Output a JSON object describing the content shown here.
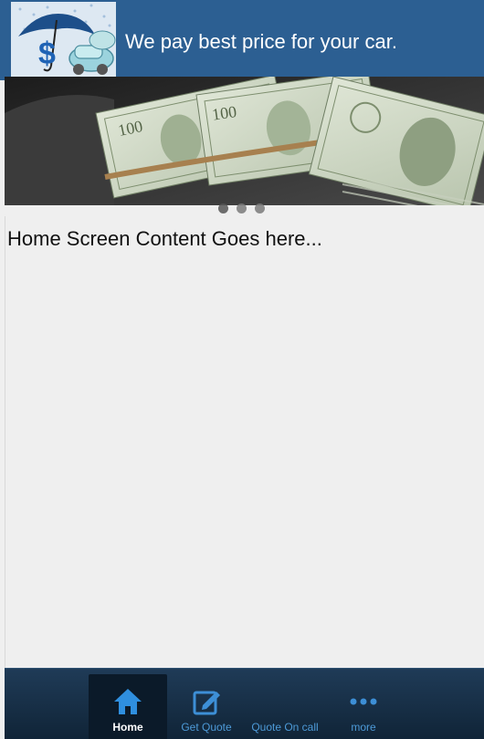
{
  "header": {
    "tagline": "We pay best price for your car."
  },
  "banner": {
    "slides": 3,
    "active_slide": 1
  },
  "main": {
    "content": "Home Screen Content Goes here..."
  },
  "tabbar": {
    "items": [
      {
        "label": "Home",
        "icon": "home-icon",
        "active": true
      },
      {
        "label": "Get Quote",
        "icon": "edit-icon",
        "active": false
      },
      {
        "label": "Quote On call",
        "icon": "phone-icon",
        "active": false
      },
      {
        "label": "more",
        "icon": "more-dots-icon",
        "active": false
      }
    ]
  },
  "colors": {
    "header_bg": "#2c5f92",
    "tab_active_icon": "#2f8fdf",
    "tab_label": "#4d9ad8",
    "navbar_bg": "#1a334c"
  }
}
